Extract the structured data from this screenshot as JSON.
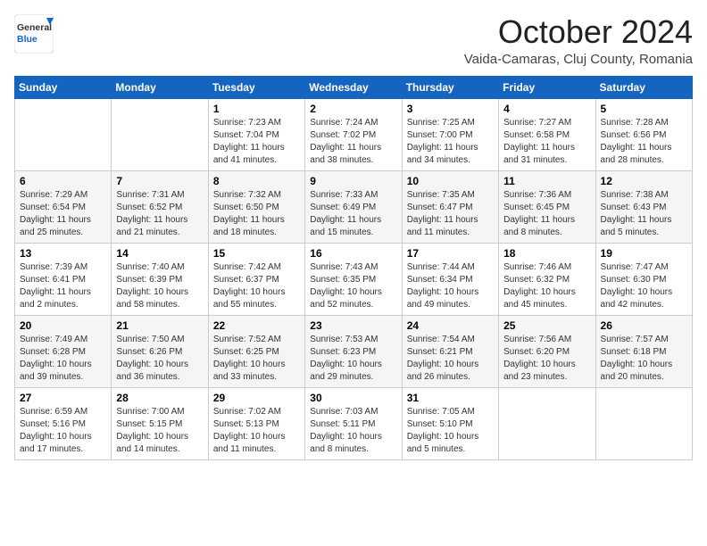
{
  "header": {
    "logo_general": "General",
    "logo_blue": "Blue",
    "month_title": "October 2024",
    "location": "Vaida-Camaras, Cluj County, Romania"
  },
  "days_of_week": [
    "Sunday",
    "Monday",
    "Tuesday",
    "Wednesday",
    "Thursday",
    "Friday",
    "Saturday"
  ],
  "weeks": [
    [
      {
        "day": "",
        "info": ""
      },
      {
        "day": "",
        "info": ""
      },
      {
        "day": "1",
        "info": "Sunrise: 7:23 AM\nSunset: 7:04 PM\nDaylight: 11 hours and 41 minutes."
      },
      {
        "day": "2",
        "info": "Sunrise: 7:24 AM\nSunset: 7:02 PM\nDaylight: 11 hours and 38 minutes."
      },
      {
        "day": "3",
        "info": "Sunrise: 7:25 AM\nSunset: 7:00 PM\nDaylight: 11 hours and 34 minutes."
      },
      {
        "day": "4",
        "info": "Sunrise: 7:27 AM\nSunset: 6:58 PM\nDaylight: 11 hours and 31 minutes."
      },
      {
        "day": "5",
        "info": "Sunrise: 7:28 AM\nSunset: 6:56 PM\nDaylight: 11 hours and 28 minutes."
      }
    ],
    [
      {
        "day": "6",
        "info": "Sunrise: 7:29 AM\nSunset: 6:54 PM\nDaylight: 11 hours and 25 minutes."
      },
      {
        "day": "7",
        "info": "Sunrise: 7:31 AM\nSunset: 6:52 PM\nDaylight: 11 hours and 21 minutes."
      },
      {
        "day": "8",
        "info": "Sunrise: 7:32 AM\nSunset: 6:50 PM\nDaylight: 11 hours and 18 minutes."
      },
      {
        "day": "9",
        "info": "Sunrise: 7:33 AM\nSunset: 6:49 PM\nDaylight: 11 hours and 15 minutes."
      },
      {
        "day": "10",
        "info": "Sunrise: 7:35 AM\nSunset: 6:47 PM\nDaylight: 11 hours and 11 minutes."
      },
      {
        "day": "11",
        "info": "Sunrise: 7:36 AM\nSunset: 6:45 PM\nDaylight: 11 hours and 8 minutes."
      },
      {
        "day": "12",
        "info": "Sunrise: 7:38 AM\nSunset: 6:43 PM\nDaylight: 11 hours and 5 minutes."
      }
    ],
    [
      {
        "day": "13",
        "info": "Sunrise: 7:39 AM\nSunset: 6:41 PM\nDaylight: 11 hours and 2 minutes."
      },
      {
        "day": "14",
        "info": "Sunrise: 7:40 AM\nSunset: 6:39 PM\nDaylight: 10 hours and 58 minutes."
      },
      {
        "day": "15",
        "info": "Sunrise: 7:42 AM\nSunset: 6:37 PM\nDaylight: 10 hours and 55 minutes."
      },
      {
        "day": "16",
        "info": "Sunrise: 7:43 AM\nSunset: 6:35 PM\nDaylight: 10 hours and 52 minutes."
      },
      {
        "day": "17",
        "info": "Sunrise: 7:44 AM\nSunset: 6:34 PM\nDaylight: 10 hours and 49 minutes."
      },
      {
        "day": "18",
        "info": "Sunrise: 7:46 AM\nSunset: 6:32 PM\nDaylight: 10 hours and 45 minutes."
      },
      {
        "day": "19",
        "info": "Sunrise: 7:47 AM\nSunset: 6:30 PM\nDaylight: 10 hours and 42 minutes."
      }
    ],
    [
      {
        "day": "20",
        "info": "Sunrise: 7:49 AM\nSunset: 6:28 PM\nDaylight: 10 hours and 39 minutes."
      },
      {
        "day": "21",
        "info": "Sunrise: 7:50 AM\nSunset: 6:26 PM\nDaylight: 10 hours and 36 minutes."
      },
      {
        "day": "22",
        "info": "Sunrise: 7:52 AM\nSunset: 6:25 PM\nDaylight: 10 hours and 33 minutes."
      },
      {
        "day": "23",
        "info": "Sunrise: 7:53 AM\nSunset: 6:23 PM\nDaylight: 10 hours and 29 minutes."
      },
      {
        "day": "24",
        "info": "Sunrise: 7:54 AM\nSunset: 6:21 PM\nDaylight: 10 hours and 26 minutes."
      },
      {
        "day": "25",
        "info": "Sunrise: 7:56 AM\nSunset: 6:20 PM\nDaylight: 10 hours and 23 minutes."
      },
      {
        "day": "26",
        "info": "Sunrise: 7:57 AM\nSunset: 6:18 PM\nDaylight: 10 hours and 20 minutes."
      }
    ],
    [
      {
        "day": "27",
        "info": "Sunrise: 6:59 AM\nSunset: 5:16 PM\nDaylight: 10 hours and 17 minutes."
      },
      {
        "day": "28",
        "info": "Sunrise: 7:00 AM\nSunset: 5:15 PM\nDaylight: 10 hours and 14 minutes."
      },
      {
        "day": "29",
        "info": "Sunrise: 7:02 AM\nSunset: 5:13 PM\nDaylight: 10 hours and 11 minutes."
      },
      {
        "day": "30",
        "info": "Sunrise: 7:03 AM\nSunset: 5:11 PM\nDaylight: 10 hours and 8 minutes."
      },
      {
        "day": "31",
        "info": "Sunrise: 7:05 AM\nSunset: 5:10 PM\nDaylight: 10 hours and 5 minutes."
      },
      {
        "day": "",
        "info": ""
      },
      {
        "day": "",
        "info": ""
      }
    ]
  ]
}
